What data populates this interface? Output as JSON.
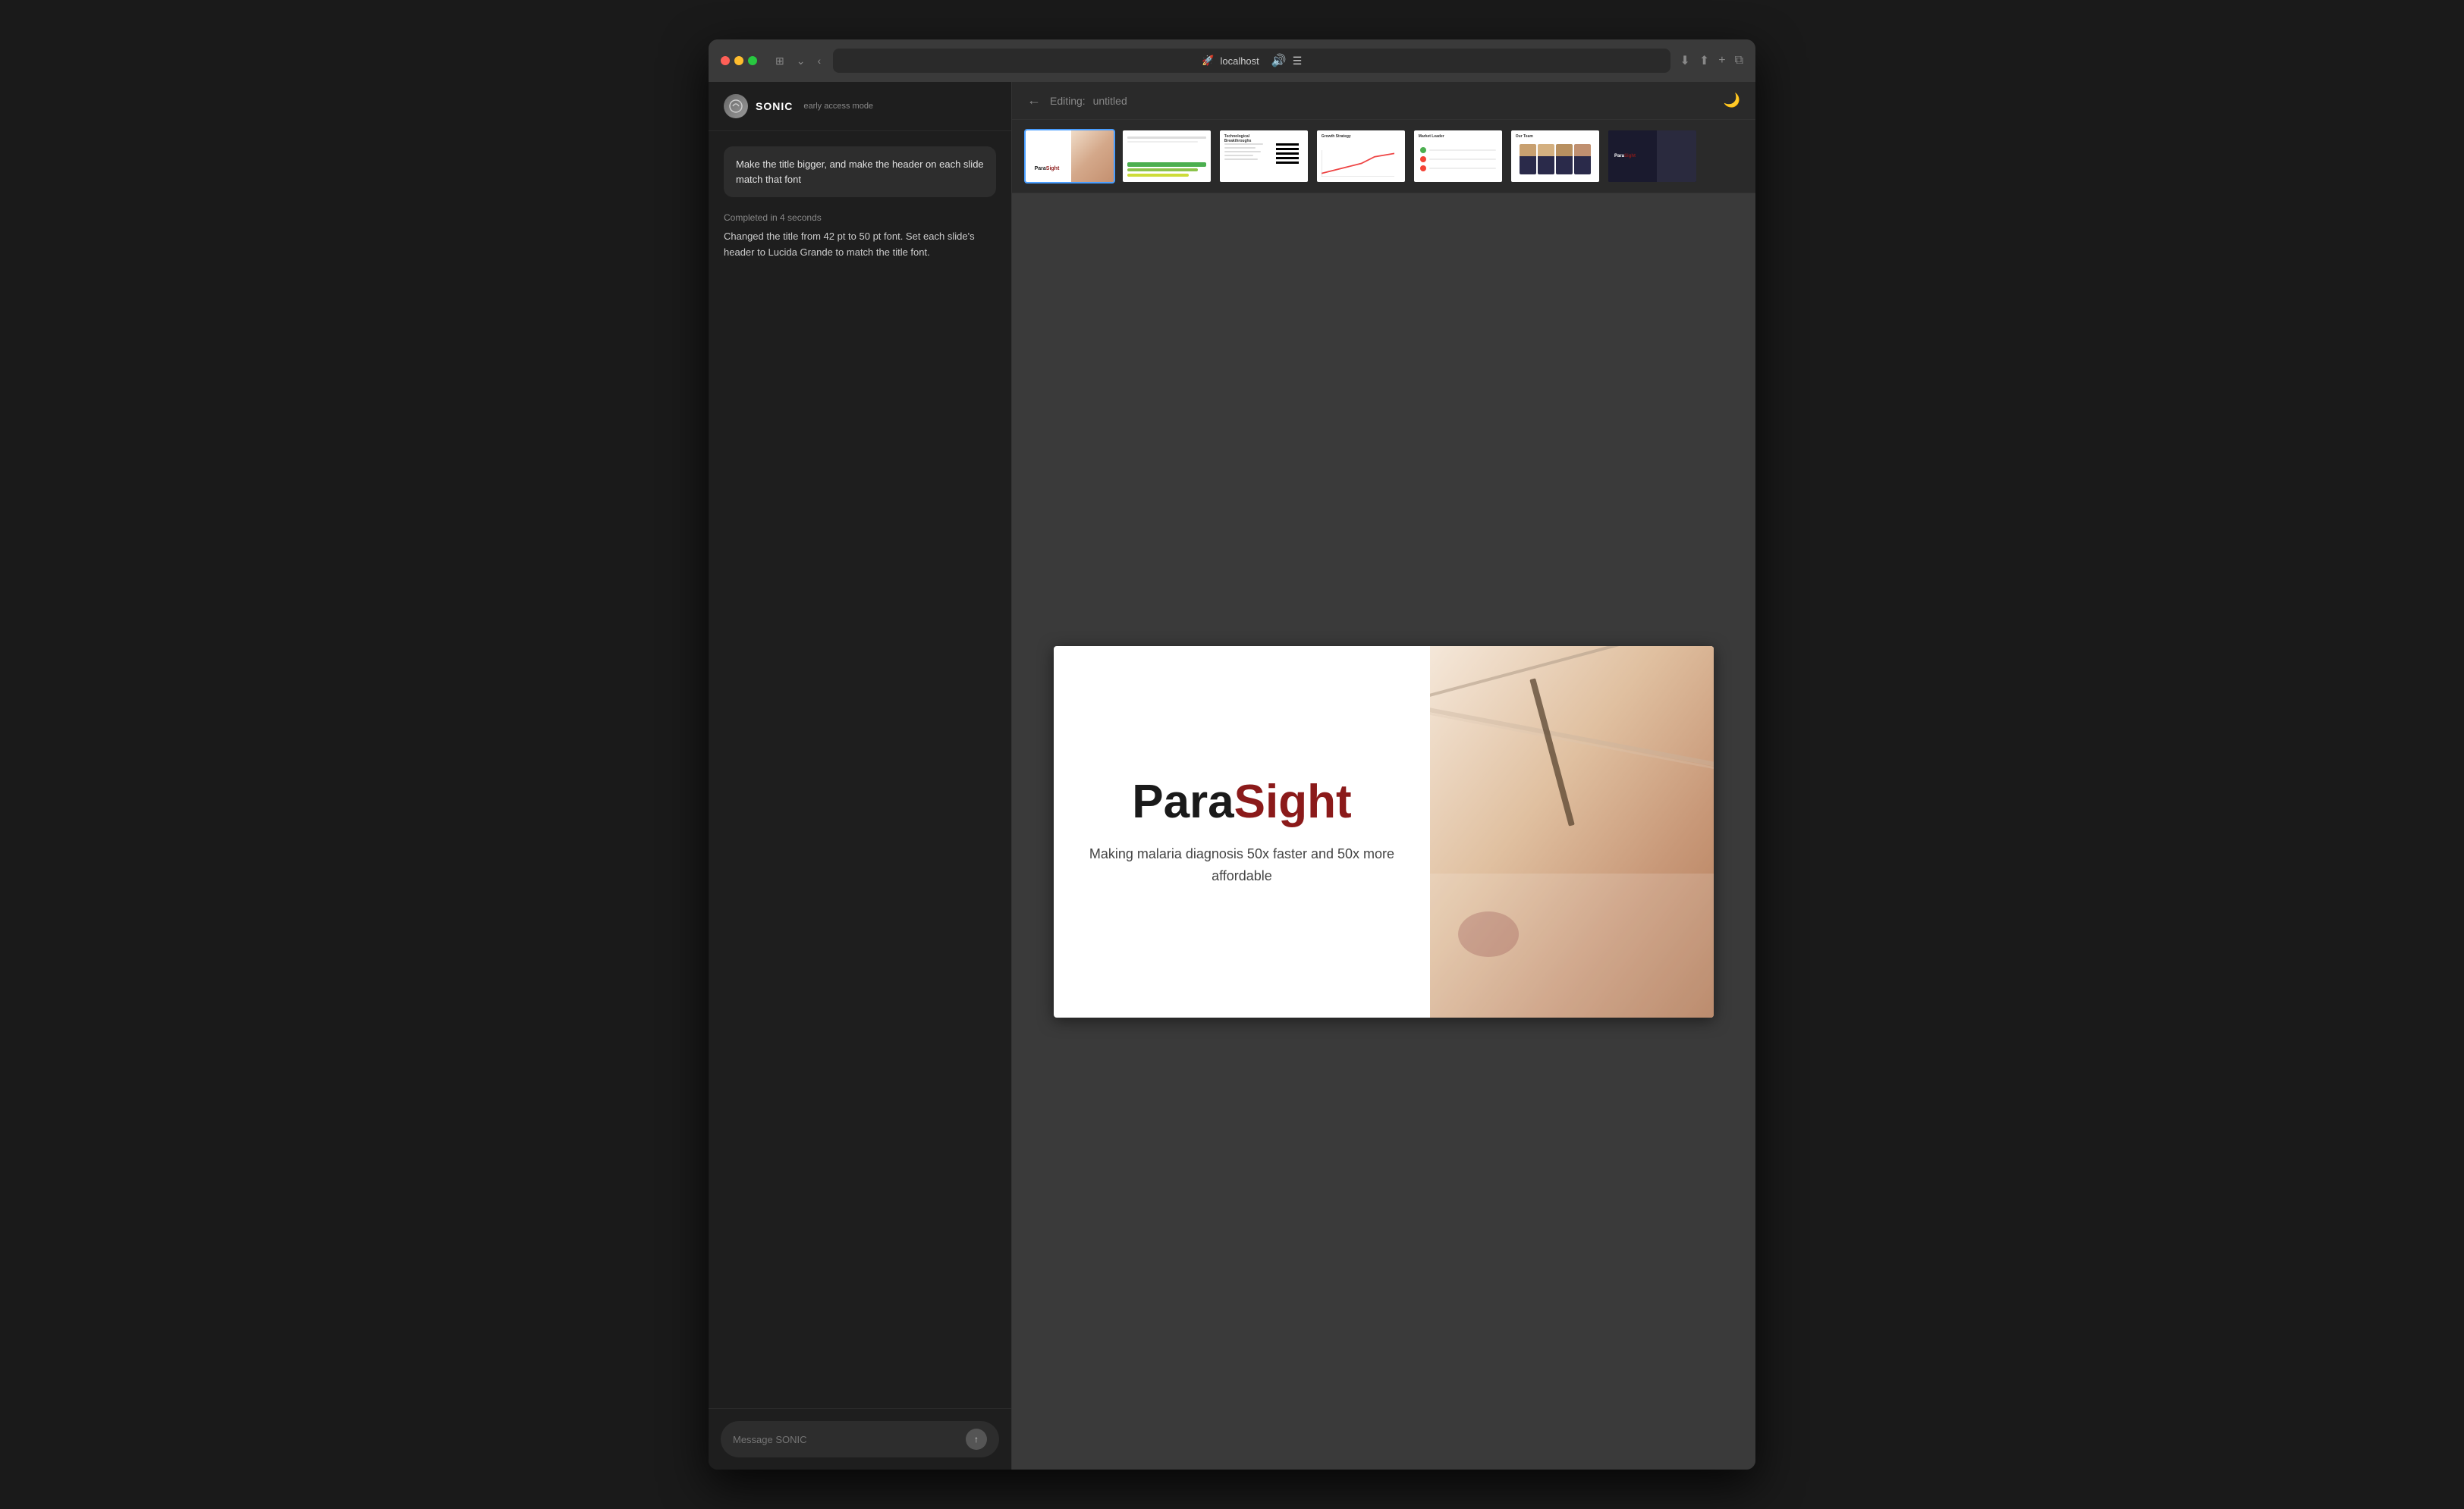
{
  "browser": {
    "address": "localhost",
    "download_icon": "⬇",
    "share_icon": "⬆",
    "add_icon": "+",
    "tab_icon": "⧉"
  },
  "sidebar": {
    "logo_text": "🚀",
    "app_name": "SONIC",
    "badge": "early access mode",
    "user_message": "Make the title bigger, and make the header on each slide match that font",
    "ai_status": "Completed in 4 seconds",
    "ai_response": "Changed the title from 42 pt to 50 pt font. Set each slide's header to Lucida Grande to match the title font.",
    "input_placeholder": "Message SONIC",
    "send_icon": "↑"
  },
  "header": {
    "back_icon": "←",
    "editing_label": "Editing:",
    "document_name": "untitled",
    "theme_icon": "🌙"
  },
  "slides": {
    "thumbnails": [
      {
        "id": 1,
        "type": "parasight",
        "active": true
      },
      {
        "id": 2,
        "type": "green",
        "active": false
      },
      {
        "id": 3,
        "type": "tech",
        "active": false
      },
      {
        "id": 4,
        "type": "growth",
        "active": false
      },
      {
        "id": 5,
        "type": "market",
        "active": false
      },
      {
        "id": 6,
        "type": "team",
        "active": false
      },
      {
        "id": 7,
        "type": "dark",
        "active": false
      }
    ]
  },
  "main_slide": {
    "title_black": "Para",
    "title_red": "Sight",
    "subtitle": "Making malaria diagnosis 50x faster and 50x more affordable"
  }
}
